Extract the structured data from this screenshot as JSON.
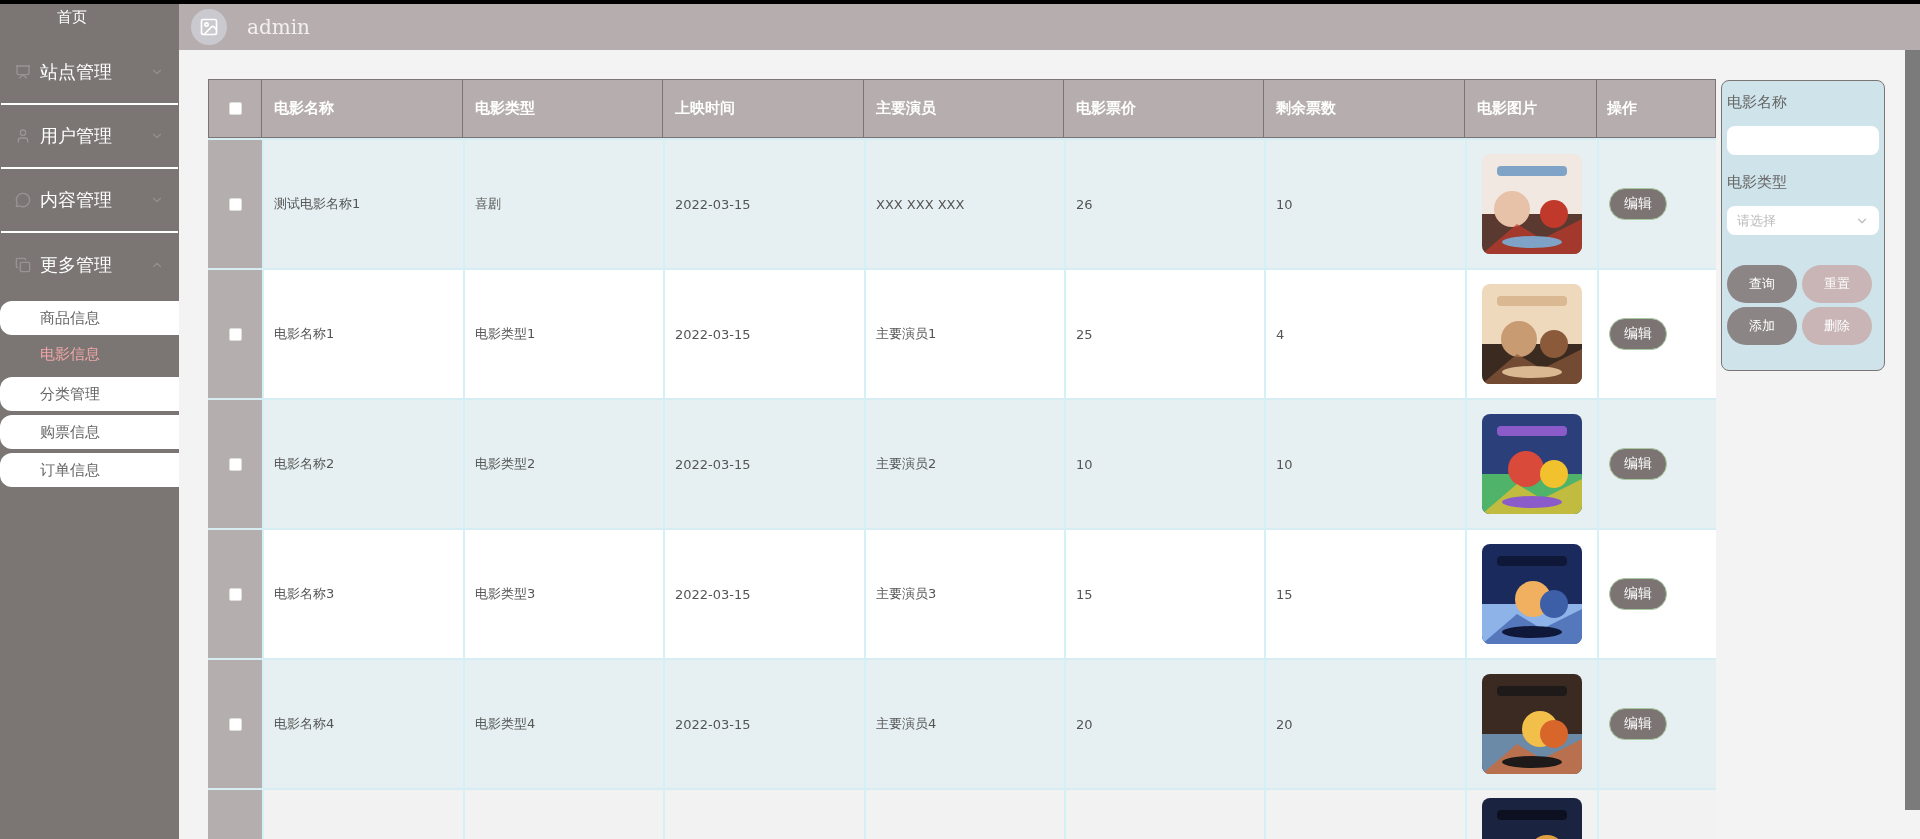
{
  "sidebar": {
    "home": "首页",
    "menus": [
      {
        "label": "站点管理",
        "expanded": false
      },
      {
        "label": "用户管理",
        "expanded": false
      },
      {
        "label": "内容管理",
        "expanded": false
      },
      {
        "label": "更多管理",
        "expanded": true,
        "children": [
          {
            "label": "商品信息",
            "selected": false
          },
          {
            "label": "电影信息",
            "selected": true
          },
          {
            "label": "分类管理",
            "selected": false
          },
          {
            "label": "购票信息",
            "selected": false
          },
          {
            "label": "订单信息",
            "selected": false
          }
        ]
      }
    ]
  },
  "header": {
    "user": "admin"
  },
  "table": {
    "select_all": {
      "checked": false
    },
    "columns": [
      "电影名称",
      "电影类型",
      "上映时间",
      "主要演员",
      "电影票价",
      "剩余票数",
      "电影图片",
      "操作"
    ],
    "rows": [
      {
        "checked": false,
        "cells": [
          "测试电影名称1",
          "喜剧",
          "2022-03-15",
          "XXX XXX XXX",
          "26",
          "10"
        ],
        "action": "编辑"
      },
      {
        "checked": false,
        "cells": [
          "电影名称1",
          "电影类型1",
          "2022-03-15",
          "主要演员1",
          "25",
          "4"
        ],
        "action": "编辑"
      },
      {
        "checked": false,
        "cells": [
          "电影名称2",
          "电影类型2",
          "2022-03-15",
          "主要演员2",
          "10",
          "10"
        ],
        "action": "编辑"
      },
      {
        "checked": false,
        "cells": [
          "电影名称3",
          "电影类型3",
          "2022-03-15",
          "主要演员3",
          "15",
          "15"
        ],
        "action": "编辑"
      },
      {
        "checked": false,
        "cells": [
          "电影名称4",
          "电影类型4",
          "2022-03-15",
          "主要演员4",
          "20",
          "20"
        ],
        "action": "编辑"
      }
    ],
    "more_rows_below": true
  },
  "filter": {
    "fields": [
      {
        "label": "电影名称",
        "kind": "input"
      },
      {
        "label": "电影类型",
        "kind": "select",
        "placeholder": "请选择"
      }
    ],
    "buttons": [
      {
        "label": "查询",
        "kind": "dark"
      },
      {
        "label": "重置",
        "kind": "light"
      },
      {
        "label": "添加",
        "kind": "dark"
      },
      {
        "label": "删除",
        "kind": "light"
      }
    ]
  }
}
